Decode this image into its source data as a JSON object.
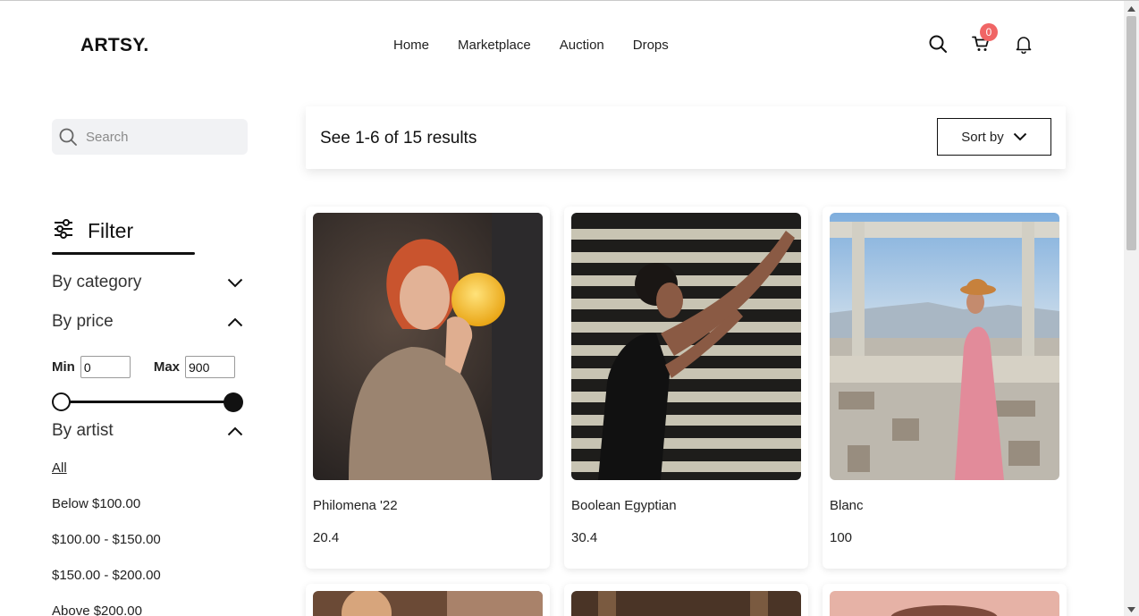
{
  "brand": {
    "logo": "ARTSY."
  },
  "nav": {
    "items": [
      "Home",
      "Marketplace",
      "Auction",
      "Drops"
    ]
  },
  "header": {
    "cart_count": "0"
  },
  "search": {
    "placeholder": "Search",
    "value": ""
  },
  "filter": {
    "title": "Filter",
    "category_label": "By category",
    "price_label": "By price",
    "min_label": "Min",
    "min_value": "0",
    "max_label": "Max",
    "max_value": "900",
    "slider_min_fraction": 0,
    "slider_max_fraction": 1,
    "artist_label": "By artist",
    "artist_options": [
      "All",
      "Below $100.00",
      "$100.00 - $150.00",
      "$150.00 - $200.00",
      "Above $200.00"
    ]
  },
  "results": {
    "summary": "See 1-6 of 15 results",
    "sort_label": "Sort by"
  },
  "products": [
    {
      "name": "Philomena '22",
      "price": "20.4"
    },
    {
      "name": "Boolean Egyptian",
      "price": "30.4"
    },
    {
      "name": "Blanc",
      "price": "100"
    }
  ],
  "colors": {
    "badge": "#f06565",
    "accent": "#111111",
    "search_bg": "#f1f2f4"
  }
}
